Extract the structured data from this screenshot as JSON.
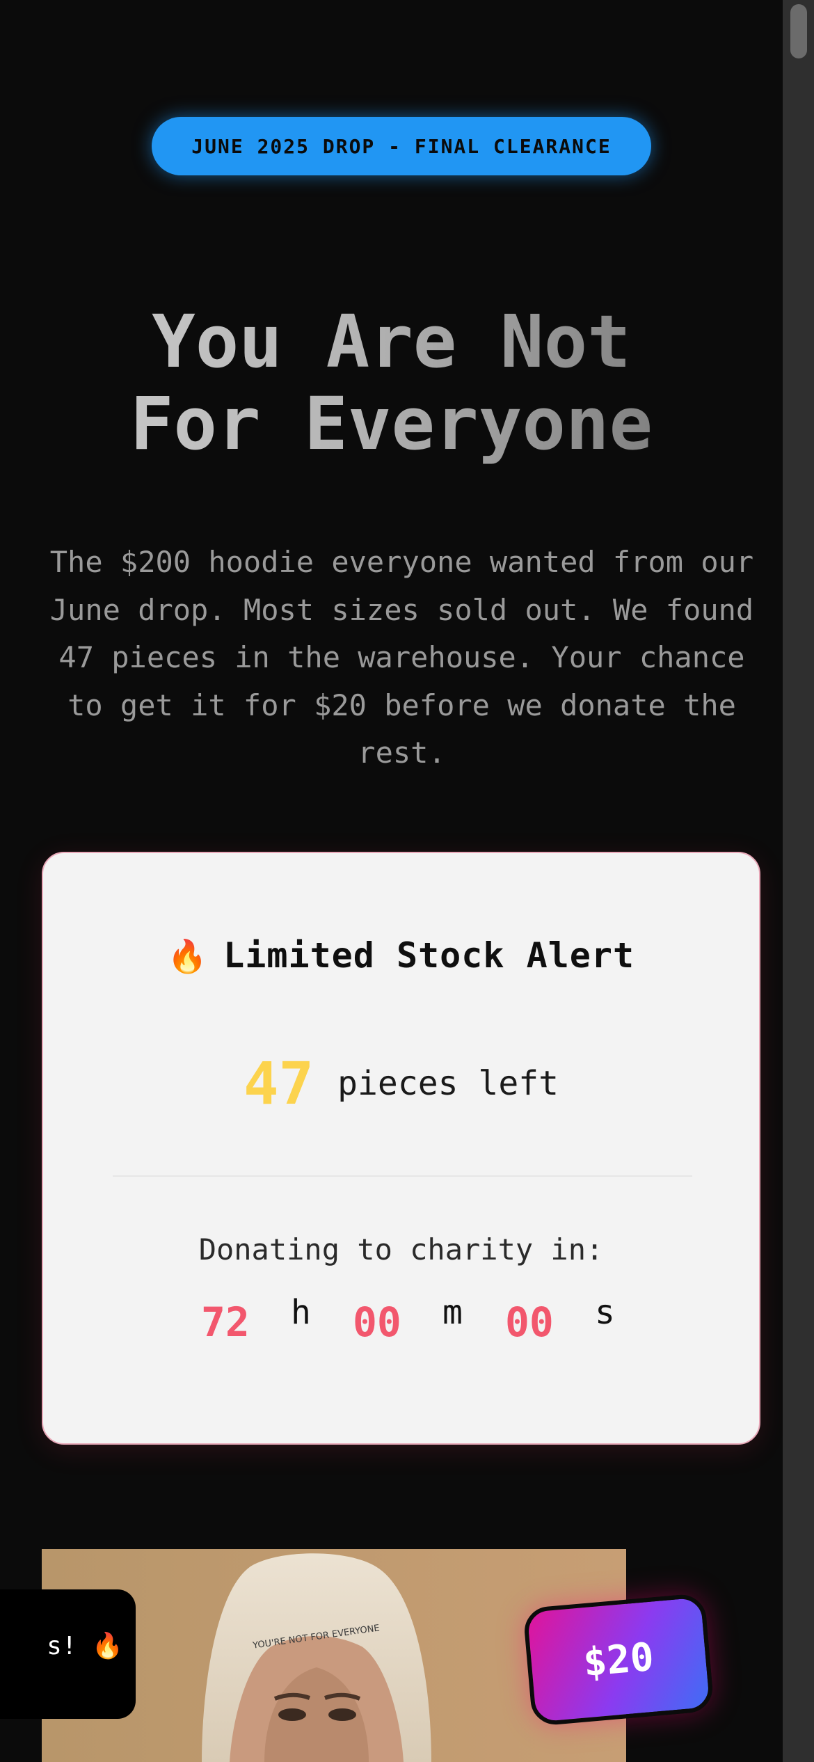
{
  "badge": {
    "text": "JUNE 2025 DROP - FINAL CLEARANCE"
  },
  "hero": {
    "title_line1": "You Are Not",
    "title_line2": "For Everyone",
    "description": "The $200 hoodie everyone wanted from our June drop. Most sizes sold out. We found 47 pieces in the warehouse. Your chance to get it for $20 before we donate the rest."
  },
  "stock_card": {
    "icon": "fire-icon",
    "icon_glyph": "🔥",
    "title": "Limited Stock Alert",
    "count": "47",
    "count_unit": "pieces left",
    "charity_label": "Donating to charity in:",
    "countdown": {
      "hours": "72",
      "hours_unit": "h",
      "minutes": "00",
      "minutes_unit": "m",
      "seconds": "00",
      "seconds_unit": "s"
    }
  },
  "product": {
    "image_caption": "YOU'RE NOT FOR EVERYONE",
    "price": "$20"
  },
  "toast": {
    "text": "s! 🔥"
  },
  "colors": {
    "badge_blue": "#2196f3",
    "stock_yellow": "#fcd34d",
    "countdown_red": "#f2576d",
    "price_gradient_start": "#e0149a",
    "price_gradient_end": "#3f6df5"
  }
}
